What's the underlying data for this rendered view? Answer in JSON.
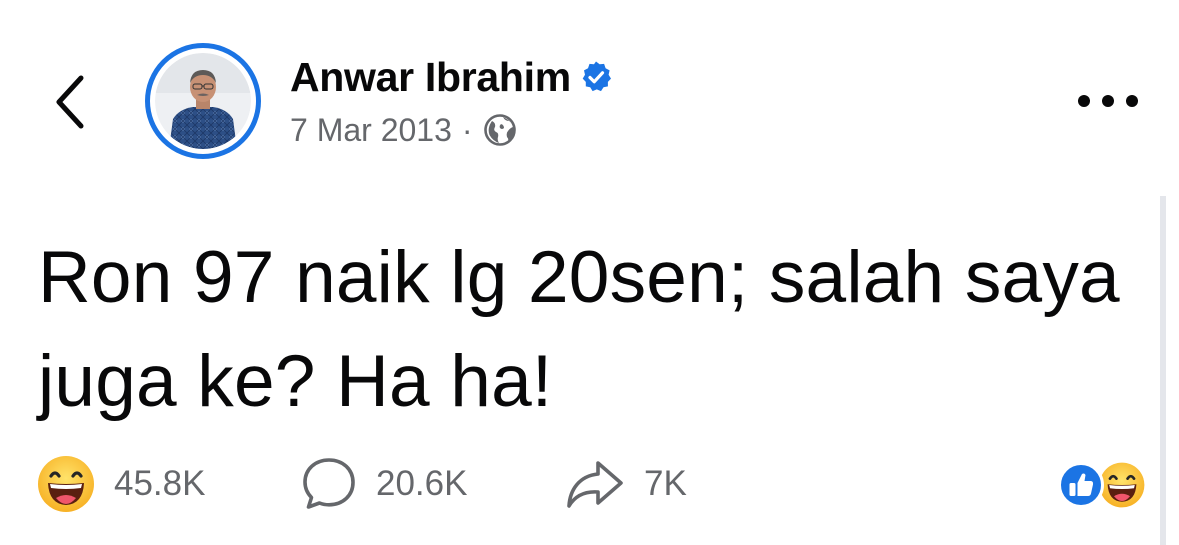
{
  "header": {
    "back_icon": "chevron-left-icon",
    "author_name": "Anwar Ibrahim",
    "verified_icon": "verified-badge-icon",
    "post_date": "7 Mar 2013",
    "separator": "·",
    "privacy_icon": "globe-icon",
    "more_icon": "more-horizontal-icon"
  },
  "post": {
    "text": "Ron 97 naik lg 20sen; salah saya juga ke? Ha ha!"
  },
  "actions": {
    "reactions": {
      "icon": "haha-emoji-icon",
      "count": "45.8K"
    },
    "comments": {
      "icon": "comment-bubble-icon",
      "count": "20.6K"
    },
    "shares": {
      "icon": "share-arrow-icon",
      "count": "7K"
    },
    "reaction_summary_icons": [
      "like-icon",
      "haha-emoji-icon"
    ]
  },
  "colors": {
    "accent": "#1b74e4",
    "text_primary": "#080809",
    "text_secondary": "#65676b",
    "haha_yellow": "#f7b125"
  }
}
